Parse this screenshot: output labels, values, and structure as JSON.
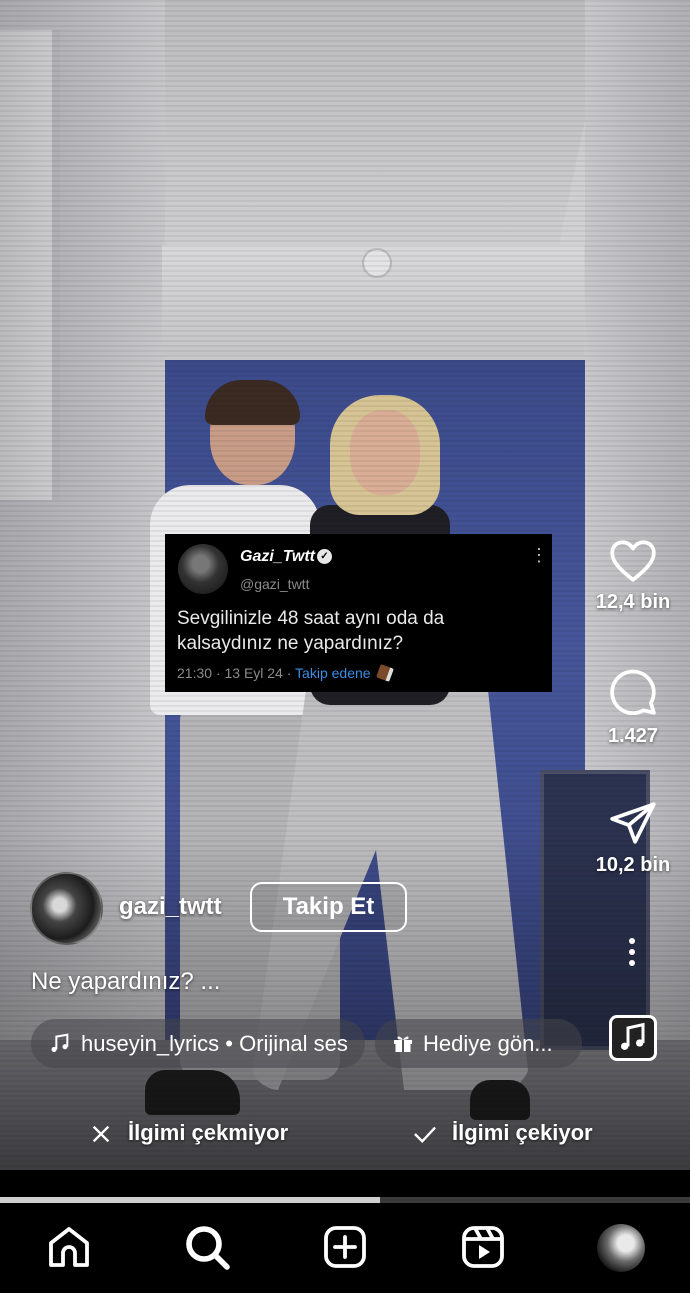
{
  "post": {
    "tweet": {
      "display_name": "Gazi_Twtt",
      "handle": "@gazi_twtt",
      "text": "Sevgilinizle 48 saat aynı oda da kalsaydınız ne yapardınız?",
      "timestamp": "21:30 · 13 Eyl 24 · ",
      "follow_label": "Takip edene"
    },
    "author": {
      "username": "gazi_twtt",
      "follow_button": "Takip Et"
    },
    "caption": "Ne yapardınız? ...",
    "audio_chip": "huseyin_lyrics • Orijinal ses",
    "gift_chip": "Hediye gön...",
    "video_progress": 0.55
  },
  "actions": {
    "likes": "12,4 bin",
    "comments": "1.427",
    "shares": "10,2 bin"
  },
  "feedback": {
    "not_interested": "İlgimi çekmiyor",
    "interested": "İlgimi çekiyor"
  },
  "tabbar": {
    "icons": [
      "home-icon",
      "search-icon",
      "create-icon",
      "reels-icon",
      "profile-avatar"
    ]
  }
}
